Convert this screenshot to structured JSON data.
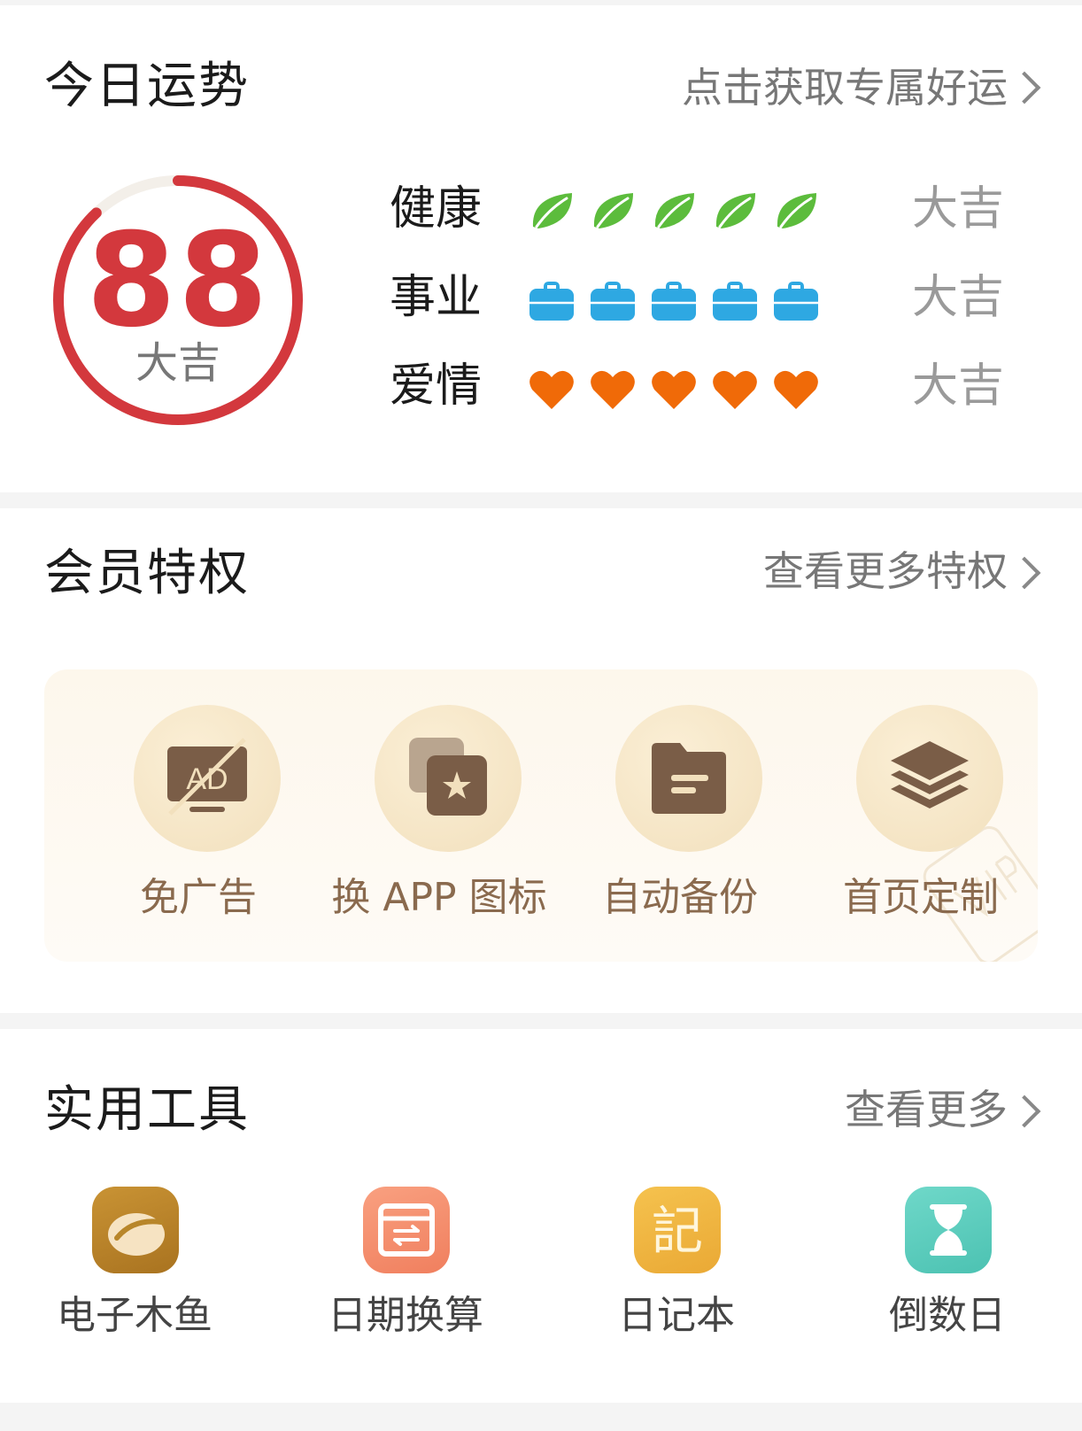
{
  "fortune": {
    "title": "今日运势",
    "link": "点击获取专属好运",
    "score": "88",
    "score_label": "大吉",
    "score_fraction": 0.88,
    "colors": {
      "ring": "#d3383d",
      "track": "#f3efe9"
    },
    "rows": [
      {
        "label": "健康",
        "icon": "leaf-icon",
        "count": 5,
        "value": "大吉",
        "color": "#5cbc3c"
      },
      {
        "label": "事业",
        "icon": "briefcase-icon",
        "count": 5,
        "value": "大吉",
        "color": "#2ea8e2"
      },
      {
        "label": "爱情",
        "icon": "heart-icon",
        "count": 5,
        "value": "大吉",
        "color": "#f06a08"
      }
    ]
  },
  "vip": {
    "title": "会员特权",
    "link": "查看更多特权",
    "watermark_icon": "vip-badge-icon",
    "items": [
      {
        "label": "免广告",
        "icon": "no-ad-icon"
      },
      {
        "label": "换 APP 图标",
        "icon": "app-icon-swap-icon"
      },
      {
        "label": "自动备份",
        "icon": "backup-folder-icon"
      },
      {
        "label": "首页定制",
        "icon": "layers-icon"
      }
    ]
  },
  "tools": {
    "title": "实用工具",
    "link": "查看更多",
    "items": [
      {
        "label": "电子木鱼",
        "icon": "wooden-fish-icon",
        "color": "#b8862a"
      },
      {
        "label": "日期换算",
        "icon": "date-convert-icon",
        "color": "#f48e6c"
      },
      {
        "label": "日记本",
        "icon": "diary-icon",
        "color": "#efb640",
        "glyph": "記"
      },
      {
        "label": "倒数日",
        "icon": "hourglass-icon",
        "color": "#5fcfc0"
      }
    ]
  }
}
